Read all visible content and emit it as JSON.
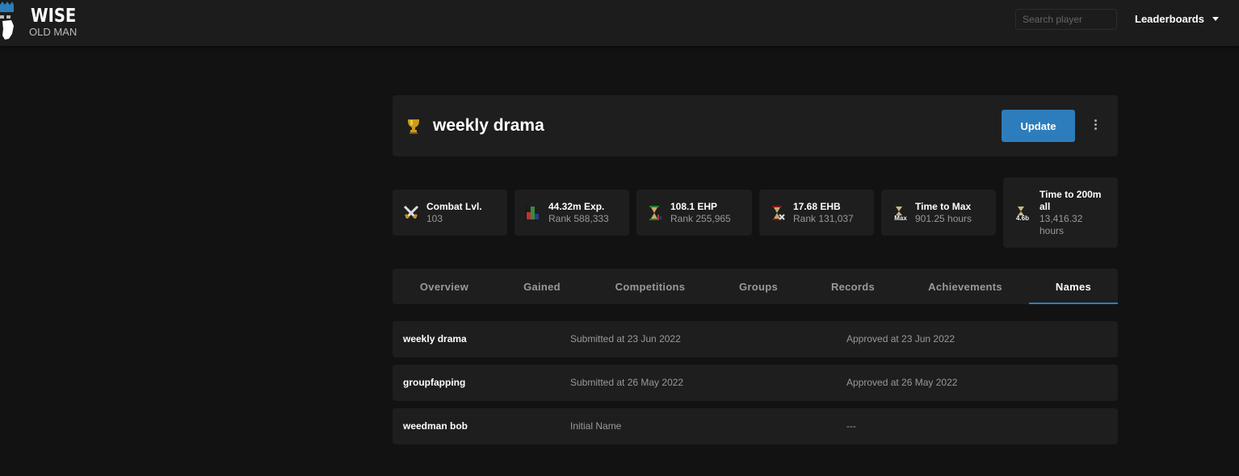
{
  "brand": {
    "line1": "WISE",
    "line2": "OLD MAN"
  },
  "nav": {
    "search_placeholder": "Search player",
    "leaderboards_label": "Leaderboards"
  },
  "player": {
    "name": "weekly drama",
    "update_label": "Update",
    "trophy_color": "#c99a1b"
  },
  "stats": [
    {
      "icon": "combat-swords-icon",
      "title": "Combat Lvl.",
      "sub": "103"
    },
    {
      "icon": "exp-bar-chart-icon",
      "title": "44.32m Exp.",
      "sub": "Rank 588,333"
    },
    {
      "icon": "ehp-hourglass-icon",
      "title": "108.1 EHP",
      "sub": "Rank 255,965"
    },
    {
      "icon": "ehb-hourglass-icon",
      "title": "17.68 EHB",
      "sub": "Rank 131,037"
    },
    {
      "icon": "max-hourglass-icon",
      "icon_label": "Max",
      "title": "Time to Max",
      "sub": "901.25 hours"
    },
    {
      "icon": "200m-hourglass-icon",
      "icon_label": "4.6b",
      "title_line1": "Time to 200m",
      "title_line2": "all",
      "sub_line1": "13,416.32",
      "sub_line2": "hours"
    }
  ],
  "tabs": [
    {
      "label": "Overview"
    },
    {
      "label": "Gained"
    },
    {
      "label": "Competitions"
    },
    {
      "label": "Groups"
    },
    {
      "label": "Records"
    },
    {
      "label": "Achievements"
    },
    {
      "label": "Names",
      "active": true
    }
  ],
  "names": [
    {
      "name": "weekly drama",
      "submitted": "Submitted at 23 Jun 2022",
      "approved": "Approved at 23 Jun 2022"
    },
    {
      "name": "groupfapping",
      "submitted": "Submitted at 26 May 2022",
      "approved": "Approved at 26 May 2022"
    },
    {
      "name": "weedman bob",
      "submitted": "Initial Name",
      "approved": "---"
    }
  ],
  "colors": {
    "accent": "#2d7dbc",
    "background": "#121212",
    "card": "#1e1e1e"
  }
}
